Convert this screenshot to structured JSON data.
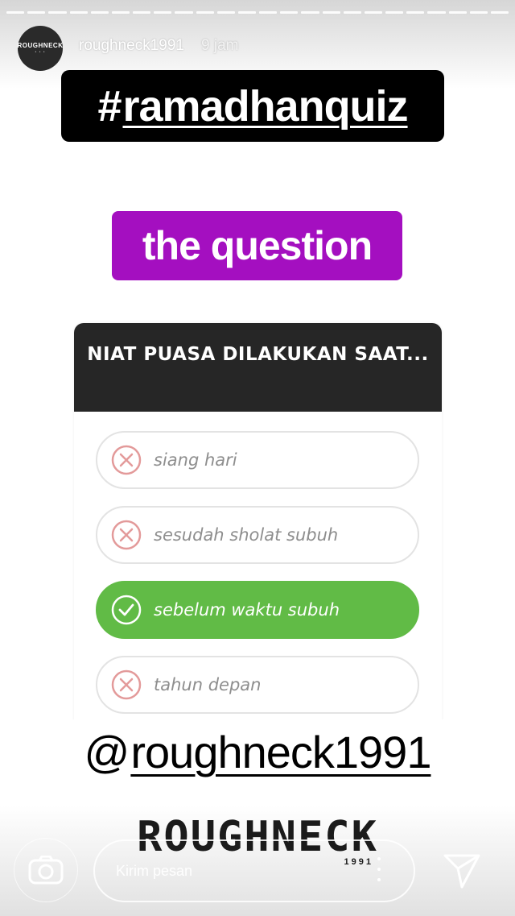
{
  "story": {
    "username": "roughneck1991",
    "time": "9 jam",
    "avatar_text": "ROUGHNECK",
    "progress_segments": 24
  },
  "stickers": {
    "hashtag_symbol": "#",
    "hashtag_word": "ramadhanquiz",
    "question_tag": "the question"
  },
  "quiz": {
    "question": "NIAT PUASA DILAKUKAN SAAT...",
    "options": [
      {
        "label": "siang hari",
        "correct": false
      },
      {
        "label": "sesudah sholat subuh",
        "correct": false
      },
      {
        "label": "sebelum waktu subuh",
        "correct": true
      },
      {
        "label": "tahun depan",
        "correct": false
      }
    ]
  },
  "mention": {
    "at": "@",
    "handle": "roughneck1991"
  },
  "logo": {
    "word": "ROUGHNECK",
    "year": "1991"
  },
  "reply_bar": {
    "placeholder": "Kirim pesan"
  },
  "colors": {
    "hashtag_bg": "#000000",
    "question_bg": "#a40fc0",
    "quiz_header": "#262626",
    "correct": "#61bb46",
    "wrong_icon": "#e39a9a"
  }
}
